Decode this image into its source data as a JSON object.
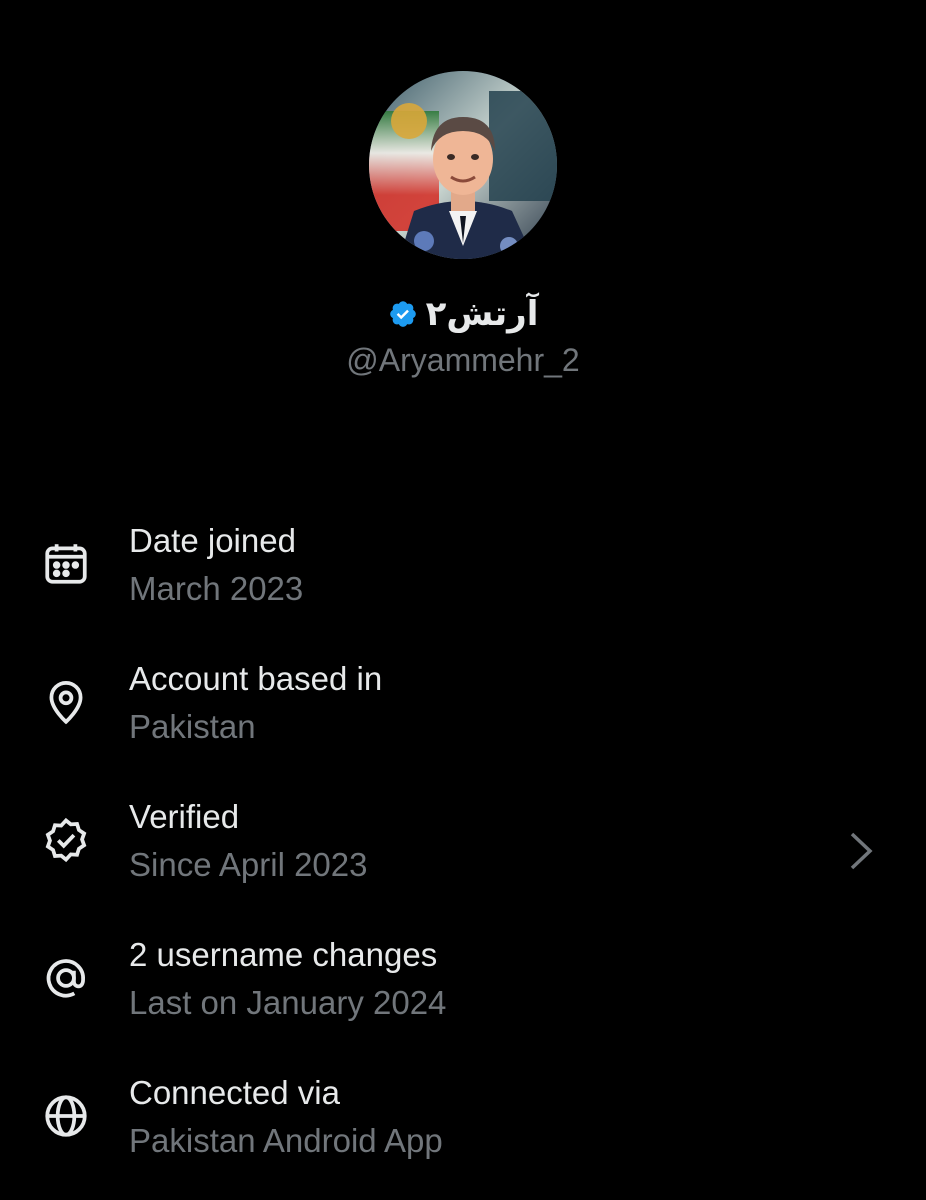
{
  "profile": {
    "display_name": "آرتش۲",
    "handle": "@Aryammehr_2",
    "verified": true,
    "badge_color": "#1d9bf0"
  },
  "about": {
    "items": [
      {
        "icon": "calendar-icon",
        "label": "Date joined",
        "value": "March 2023",
        "has_chevron": false
      },
      {
        "icon": "location-pin-icon",
        "label": "Account based in",
        "value": "Pakistan",
        "has_chevron": false
      },
      {
        "icon": "verified-badge-icon",
        "label": "Verified",
        "value": "Since April 2023",
        "has_chevron": true
      },
      {
        "icon": "at-sign-icon",
        "label": "2 username changes",
        "value": "Last on January 2024",
        "has_chevron": false
      },
      {
        "icon": "globe-icon",
        "label": "Connected via",
        "value": "Pakistan Android App",
        "has_chevron": false
      }
    ]
  },
  "colors": {
    "background": "#000000",
    "primary_text": "#e7e9ea",
    "secondary_text": "#71767b",
    "accent": "#1d9bf0"
  }
}
